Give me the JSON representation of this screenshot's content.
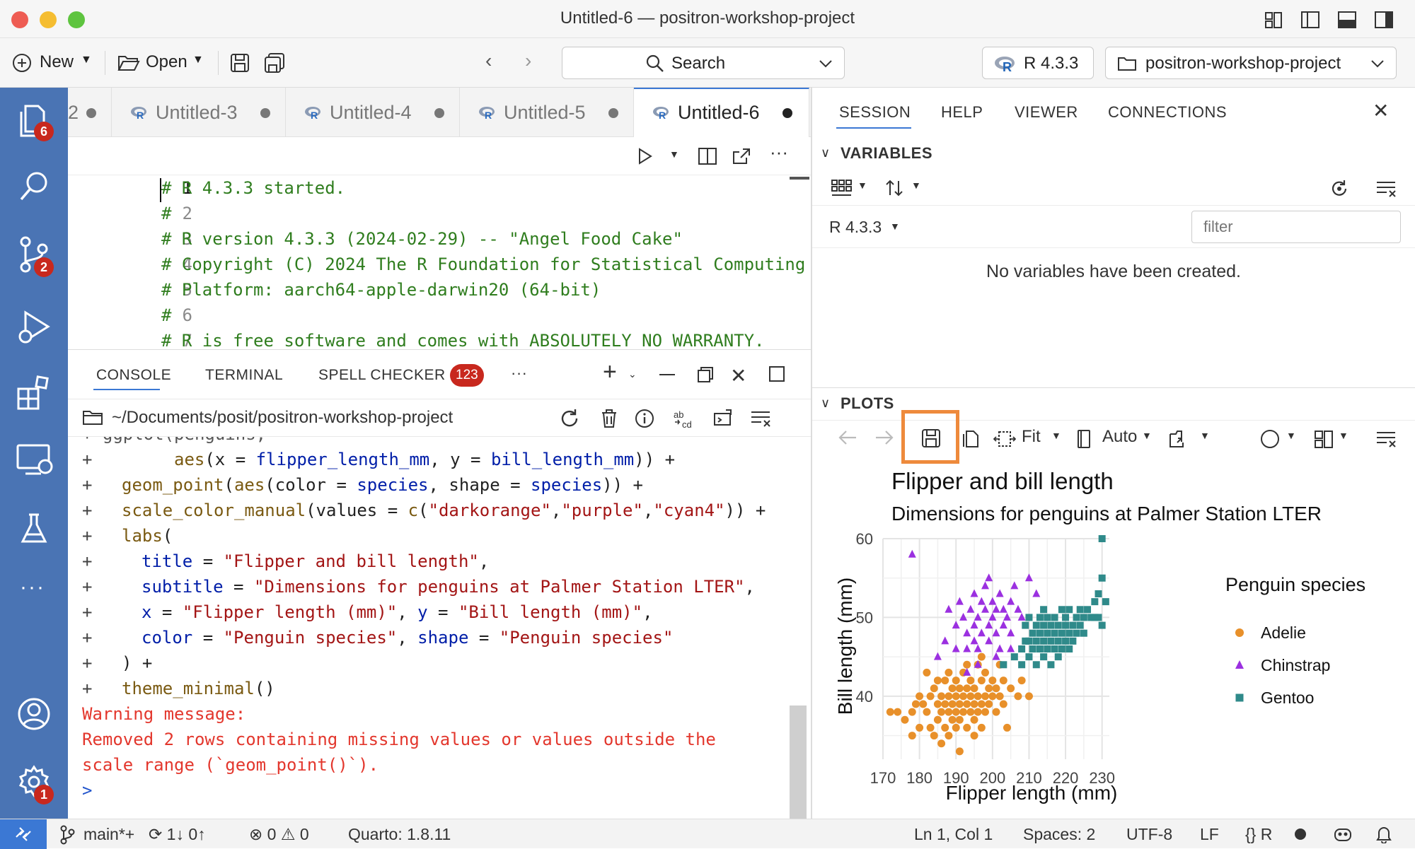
{
  "window": {
    "title": "Untitled-6 — positron-workshop-project"
  },
  "toolbar": {
    "new_label": "New",
    "open_label": "Open",
    "search_label": "Search",
    "interpreter_label": "R 4.3.3",
    "project_label": "positron-workshop-project"
  },
  "activity": {
    "explorer_badge": "6",
    "scm_badge": "2",
    "settings_badge": "1"
  },
  "editor": {
    "tabs": [
      {
        "label": "2"
      },
      {
        "label": "Untitled-3"
      },
      {
        "label": "Untitled-4"
      },
      {
        "label": "Untitled-5"
      },
      {
        "label": "Untitled-6"
      }
    ],
    "lines": [
      {
        "num": "1",
        "text": "# R 4.3.3 started."
      },
      {
        "num": "2",
        "text": "#"
      },
      {
        "num": "3",
        "text": "# R version 4.3.3 (2024-02-29) -- \"Angel Food Cake\""
      },
      {
        "num": "4",
        "text": "# Copyright (C) 2024 The R Foundation for Statistical Computing"
      },
      {
        "num": "5",
        "text": "# Platform: aarch64-apple-darwin20 (64-bit)"
      },
      {
        "num": "6",
        "text": "#"
      },
      {
        "num": "7",
        "text": "# R is free software and comes with ABSOLUTELY NO WARRANTY."
      }
    ]
  },
  "panel": {
    "tabs": {
      "console": "CONSOLE",
      "terminal": "TERMINAL",
      "spell": "SPELL CHECKER",
      "spell_count": "123",
      "more": "···"
    },
    "path": "~/Documents/posit/positron-workshop-project",
    "console": {
      "l0": "+ ggplot(penguins,",
      "l1_a": "aes",
      "l1_b": "(x = ",
      "l1_c": "flipper_length_mm",
      "l1_d": ", y = ",
      "l1_e": "bill_length_mm",
      "l1_f": ")) +",
      "l2_a": "geom_point",
      "l2_b": "(",
      "l2_c": "aes",
      "l2_d": "(color = ",
      "l2_e": "species",
      "l2_f": ", shape = ",
      "l2_g": "species",
      "l2_h": ")) +",
      "l3_a": "scale_color_manual",
      "l3_b": "(values = ",
      "l3_c": "c",
      "l3_d": "(",
      "l3_e": "\"darkorange\"",
      "l3_f": ",",
      "l3_g": "\"purple\"",
      "l3_h": ",",
      "l3_i": "\"cyan4\"",
      "l3_j": ")) +",
      "l4_a": "labs",
      "l4_b": "(",
      "l5_a": "title",
      "l5_b": " = ",
      "l5_c": "\"Flipper and bill length\"",
      "l5_d": ",",
      "l6_a": "subtitle",
      "l6_b": " = ",
      "l6_c": "\"Dimensions for penguins at Palmer Station LTER\"",
      "l6_d": ",",
      "l7_a": "x",
      "l7_b": " = ",
      "l7_c": "\"Flipper length (mm)\"",
      "l7_d": ", ",
      "l7_e": "y",
      "l7_f": " = ",
      "l7_g": "\"Bill length (mm)\"",
      "l7_h": ",",
      "l8_a": "color",
      "l8_b": " = ",
      "l8_c": "\"Penguin species\"",
      "l8_d": ", ",
      "l8_e": "shape",
      "l8_f": " = ",
      "l8_g": "\"Penguin species\"",
      "l9": ") +",
      "l10_a": "theme_minimal",
      "l10_b": "()",
      "warn1": "Warning message:",
      "warn2": "Removed 2 rows containing missing values or values outside the",
      "warn3": "scale range (`geom_point()`).",
      "prompt": ">"
    }
  },
  "session": {
    "tabs": {
      "session": "SESSION",
      "help": "HELP",
      "viewer": "VIEWER",
      "connections": "CONNECTIONS"
    },
    "variables_header": "VARIABLES",
    "env_label": "R 4.3.3",
    "filter_placeholder": "filter",
    "empty_message": "No variables have been created.",
    "plots_header": "PLOTS",
    "fit_label": "Fit",
    "auto_label": "Auto"
  },
  "chart_data": {
    "type": "scatter",
    "title": "Flipper and bill length",
    "subtitle": "Dimensions for penguins at Palmer Station LTER",
    "xlabel": "Flipper length (mm)",
    "ylabel": "Bill length (mm)",
    "xlim": [
      170,
      232
    ],
    "ylim": [
      32,
      60
    ],
    "xticks": [
      "170",
      "180",
      "190",
      "200",
      "210",
      "220",
      "230"
    ],
    "yticks": [
      "40",
      "50",
      "60"
    ],
    "legend_title": "Penguin species",
    "legend_position": "right",
    "grid": true,
    "series": [
      {
        "name": "Adelie",
        "color": "#e8902a",
        "shape": "circle",
        "points": [
          [
            172,
            38
          ],
          [
            174,
            38
          ],
          [
            176,
            37
          ],
          [
            178,
            38
          ],
          [
            179,
            39
          ],
          [
            180,
            36
          ],
          [
            180,
            40
          ],
          [
            181,
            39
          ],
          [
            182,
            38
          ],
          [
            183,
            40
          ],
          [
            183,
            36
          ],
          [
            184,
            41
          ],
          [
            185,
            39
          ],
          [
            185,
            37
          ],
          [
            186,
            38
          ],
          [
            186,
            40
          ],
          [
            187,
            39
          ],
          [
            187,
            36
          ],
          [
            187,
            42
          ],
          [
            188,
            38
          ],
          [
            188,
            40
          ],
          [
            189,
            37
          ],
          [
            189,
            39
          ],
          [
            189,
            41
          ],
          [
            190,
            38
          ],
          [
            190,
            40
          ],
          [
            190,
            36
          ],
          [
            190,
            42
          ],
          [
            191,
            39
          ],
          [
            191,
            41
          ],
          [
            191,
            37
          ],
          [
            192,
            38
          ],
          [
            192,
            40
          ],
          [
            192,
            43
          ],
          [
            193,
            39
          ],
          [
            193,
            36
          ],
          [
            193,
            41
          ],
          [
            194,
            38
          ],
          [
            194,
            40
          ],
          [
            194,
            42
          ],
          [
            195,
            37
          ],
          [
            195,
            39
          ],
          [
            195,
            41
          ],
          [
            196,
            38
          ],
          [
            196,
            40
          ],
          [
            196,
            44
          ],
          [
            197,
            39
          ],
          [
            197,
            42
          ],
          [
            197,
            36
          ],
          [
            198,
            40
          ],
          [
            198,
            38
          ],
          [
            198,
            43
          ],
          [
            199,
            41
          ],
          [
            199,
            39
          ],
          [
            200,
            40
          ],
          [
            200,
            42
          ],
          [
            201,
            38
          ],
          [
            201,
            41
          ],
          [
            202,
            40
          ],
          [
            202,
            44
          ],
          [
            203,
            39
          ],
          [
            203,
            42
          ],
          [
            205,
            41
          ],
          [
            207,
            40
          ],
          [
            208,
            42
          ],
          [
            210,
            40
          ],
          [
            184,
            35
          ],
          [
            186,
            34
          ],
          [
            188,
            35
          ],
          [
            191,
            33
          ],
          [
            195,
            35
          ],
          [
            182,
            43
          ],
          [
            185,
            42
          ],
          [
            178,
            35
          ],
          [
            188,
            43
          ],
          [
            193,
            44
          ],
          [
            197,
            45
          ],
          [
            204,
            36
          ]
        ]
      },
      {
        "name": "Chinstrap",
        "color": "#9b30e0",
        "shape": "triangle",
        "points": [
          [
            178,
            58
          ],
          [
            187,
            47
          ],
          [
            188,
            51
          ],
          [
            190,
            49
          ],
          [
            190,
            46
          ],
          [
            191,
            52
          ],
          [
            192,
            50
          ],
          [
            193,
            48
          ],
          [
            193,
            46
          ],
          [
            194,
            51
          ],
          [
            195,
            53
          ],
          [
            195,
            49
          ],
          [
            195,
            47
          ],
          [
            196,
            50
          ],
          [
            196,
            46
          ],
          [
            197,
            52
          ],
          [
            197,
            48
          ],
          [
            198,
            51
          ],
          [
            198,
            54
          ],
          [
            199,
            49
          ],
          [
            199,
            47
          ],
          [
            200,
            50
          ],
          [
            200,
            52
          ],
          [
            201,
            48
          ],
          [
            201,
            51
          ],
          [
            202,
            53
          ],
          [
            202,
            46
          ],
          [
            203,
            49
          ],
          [
            203,
            51
          ],
          [
            204,
            50
          ],
          [
            205,
            52
          ],
          [
            205,
            48
          ],
          [
            206,
            54
          ],
          [
            207,
            51
          ],
          [
            208,
            50
          ],
          [
            210,
            55
          ],
          [
            212,
            53
          ],
          [
            193,
            43
          ],
          [
            196,
            44
          ],
          [
            201,
            45
          ],
          [
            185,
            45
          ],
          [
            199,
            55
          ],
          [
            205,
            46
          ]
        ]
      },
      {
        "name": "Gentoo",
        "color": "#2f8a8a",
        "shape": "square",
        "points": [
          [
            203,
            44
          ],
          [
            206,
            45
          ],
          [
            208,
            46
          ],
          [
            208,
            44
          ],
          [
            209,
            47
          ],
          [
            209,
            49
          ],
          [
            210,
            45
          ],
          [
            210,
            47
          ],
          [
            210,
            50
          ],
          [
            211,
            46
          ],
          [
            211,
            48
          ],
          [
            212,
            44
          ],
          [
            212,
            47
          ],
          [
            212,
            49
          ],
          [
            213,
            46
          ],
          [
            213,
            48
          ],
          [
            213,
            50
          ],
          [
            214,
            45
          ],
          [
            214,
            47
          ],
          [
            214,
            49
          ],
          [
            214,
            51
          ],
          [
            215,
            46
          ],
          [
            215,
            48
          ],
          [
            215,
            50
          ],
          [
            216,
            44
          ],
          [
            216,
            47
          ],
          [
            216,
            49
          ],
          [
            217,
            46
          ],
          [
            217,
            48
          ],
          [
            217,
            50
          ],
          [
            218,
            45
          ],
          [
            218,
            47
          ],
          [
            218,
            49
          ],
          [
            219,
            46
          ],
          [
            219,
            48
          ],
          [
            219,
            51
          ],
          [
            220,
            47
          ],
          [
            220,
            49
          ],
          [
            220,
            50
          ],
          [
            221,
            46
          ],
          [
            221,
            48
          ],
          [
            221,
            51
          ],
          [
            222,
            47
          ],
          [
            222,
            49
          ],
          [
            223,
            48
          ],
          [
            223,
            50
          ],
          [
            224,
            49
          ],
          [
            224,
            51
          ],
          [
            225,
            48
          ],
          [
            225,
            50
          ],
          [
            226,
            51
          ],
          [
            227,
            50
          ],
          [
            228,
            52
          ],
          [
            228,
            50
          ],
          [
            229,
            53
          ],
          [
            230,
            55
          ],
          [
            230,
            49
          ],
          [
            231,
            52
          ],
          [
            230,
            60
          ],
          [
            229,
            50
          ]
        ]
      }
    ]
  }
}
